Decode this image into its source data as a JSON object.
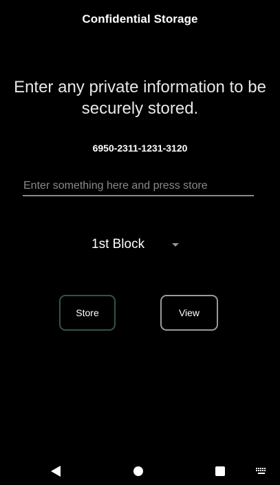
{
  "app": {
    "title": "Confidential Storage"
  },
  "main": {
    "prompt": "Enter any private information to be securely stored.",
    "stored_value": "6950-2311-1231-3120",
    "input": {
      "value": "",
      "placeholder": "Enter something here and press store"
    },
    "block_selector": {
      "selected": "1st Block"
    },
    "buttons": {
      "store_label": "Store",
      "view_label": "View"
    }
  },
  "nav_bar": {
    "icons": [
      "back-icon",
      "home-icon",
      "recents-icon",
      "keyboard-icon"
    ]
  },
  "colors": {
    "background": "#000000",
    "text": "#ffffff",
    "placeholder": "#8a8a8a",
    "store_border": "#33544a",
    "view_border": "#9a9a9a"
  }
}
